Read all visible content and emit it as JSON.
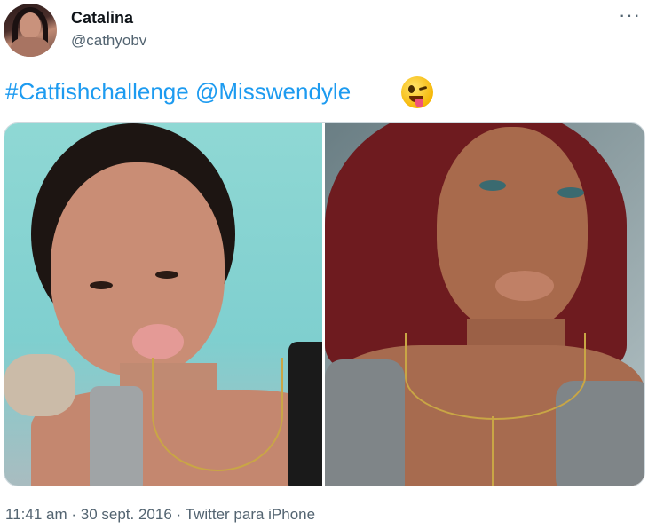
{
  "author": {
    "display_name": "Catalina",
    "handle": "@cathyobv"
  },
  "menu": {
    "more_label": "···"
  },
  "tweet": {
    "hashtag": "#Catfishchallenge",
    "mention": "@Misswendyle",
    "emoji_icon": "winking-face-with-tongue-icon"
  },
  "media": {
    "photos": [
      {
        "icon": "photo-selfie-icon"
      },
      {
        "icon": "photo-selfie-icon"
      }
    ]
  },
  "meta": {
    "time": "11:41 am",
    "separator1": "·",
    "date": "30 sept. 2016",
    "separator2": "·",
    "source": "Twitter para iPhone"
  },
  "colors": {
    "link": "#1d9bf0",
    "secondary_text": "#536471",
    "border": "#cfd9de"
  }
}
